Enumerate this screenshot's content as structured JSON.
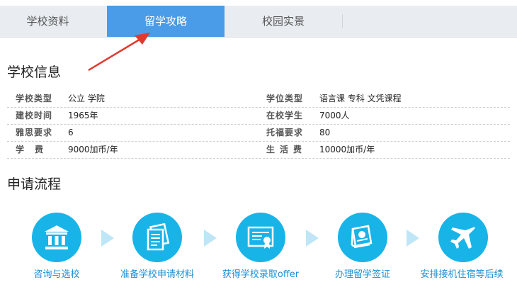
{
  "tabs": [
    {
      "label": "学校资料",
      "active": false
    },
    {
      "label": "留学攻略",
      "active": true
    },
    {
      "label": "校园实景",
      "active": false
    }
  ],
  "school_info": {
    "title": "学校信息",
    "rows": [
      {
        "l1": "学校类型",
        "v1": "公立 学院",
        "l2": "学位类型",
        "v2": "语言课 专科 文凭课程"
      },
      {
        "l1": "建校时间",
        "v1": "1965年",
        "l2": "在校学生",
        "v2": "7000人"
      },
      {
        "l1": "雅思要求",
        "v1": "6",
        "l2": "托福要求",
        "v2": "80"
      },
      {
        "l1": "学费",
        "v1": "9000加币/年",
        "l2": "生活费",
        "v2": "10000加币/年"
      }
    ]
  },
  "process": {
    "title": "申请流程",
    "steps": [
      {
        "label": "咨询与选校",
        "icon": "school-building-icon"
      },
      {
        "label": "准备学校申请材料",
        "icon": "document-icon"
      },
      {
        "label": "获得学校录取offer",
        "icon": "certificate-icon"
      },
      {
        "label": "办理留学签证",
        "icon": "passport-icon"
      },
      {
        "label": "安排接机住宿等后续",
        "icon": "airplane-icon"
      }
    ]
  },
  "colors": {
    "accent": "#4a9be8",
    "step": "#18b4e8",
    "arrow": "#e03a2f",
    "chevron": "#bfe6f7"
  }
}
